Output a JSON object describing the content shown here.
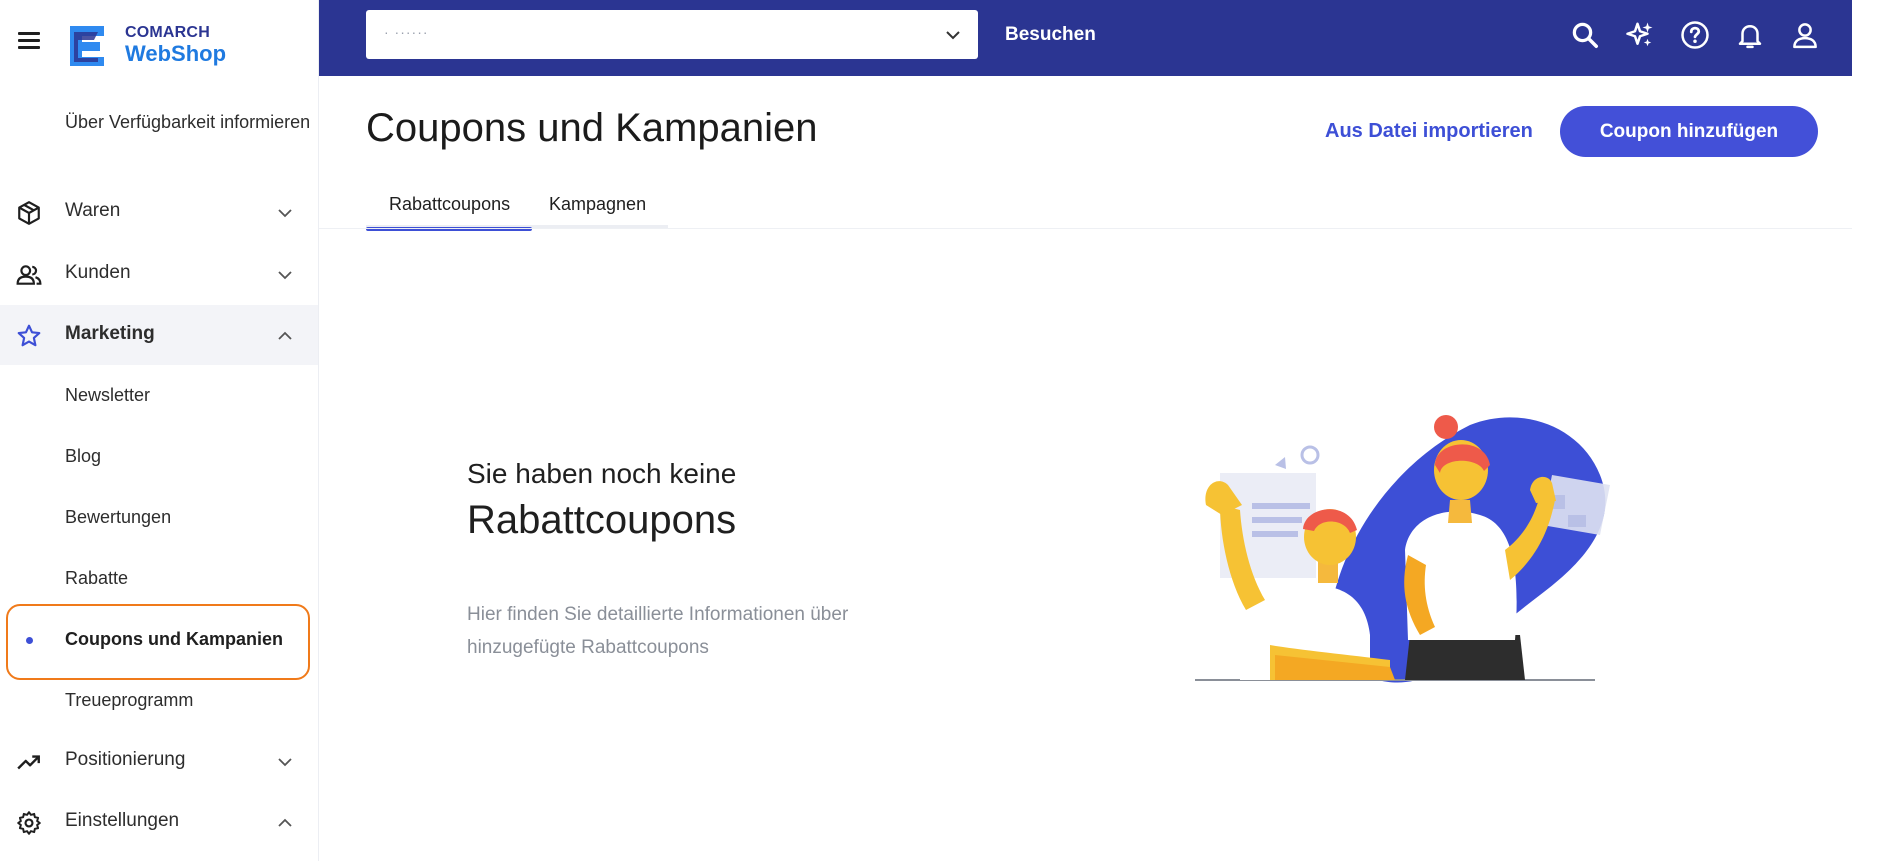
{
  "app": {
    "brand": "COMARCH",
    "product": "WebShop"
  },
  "sidebar": {
    "partial_item": "Über Verfügbarkeit informieren",
    "items": [
      {
        "label": "Waren",
        "icon": "cube-icon"
      },
      {
        "label": "Kunden",
        "icon": "people-icon"
      },
      {
        "label": "Marketing",
        "icon": "star-icon"
      },
      {
        "label": "Positionierung",
        "icon": "trending-up-icon"
      },
      {
        "label": "Einstellungen",
        "icon": "gear-icon"
      }
    ],
    "marketing_children": [
      {
        "label": "Newsletter"
      },
      {
        "label": "Blog"
      },
      {
        "label": "Bewertungen"
      },
      {
        "label": "Rabatte"
      },
      {
        "label": "Coupons und Kampanien"
      },
      {
        "label": "Treueprogramm"
      }
    ]
  },
  "topbar": {
    "shop_select_value": "· ······",
    "visit_label": "Besuchen",
    "icons": [
      "search-icon",
      "sparkle-icon",
      "help-icon",
      "bell-icon",
      "user-icon"
    ]
  },
  "main": {
    "title": "Coupons und Kampanien",
    "import_label": "Aus Datei importieren",
    "add_button_label": "Coupon hinzufügen",
    "tabs": [
      {
        "label": "Rabattcoupons",
        "active": true
      },
      {
        "label": "Kampagnen",
        "active": false
      }
    ],
    "empty_state": {
      "line1": "Sie haben noch keine",
      "line2": "Rabattcoupons",
      "description": "Hier finden Sie detaillierte Informationen über hinzugefügte Rabattcoupons"
    }
  },
  "colors": {
    "topbar": "#2b3592",
    "accent": "#3d4fd6",
    "button": "#4350d8",
    "highlight": "#f07a1a"
  }
}
